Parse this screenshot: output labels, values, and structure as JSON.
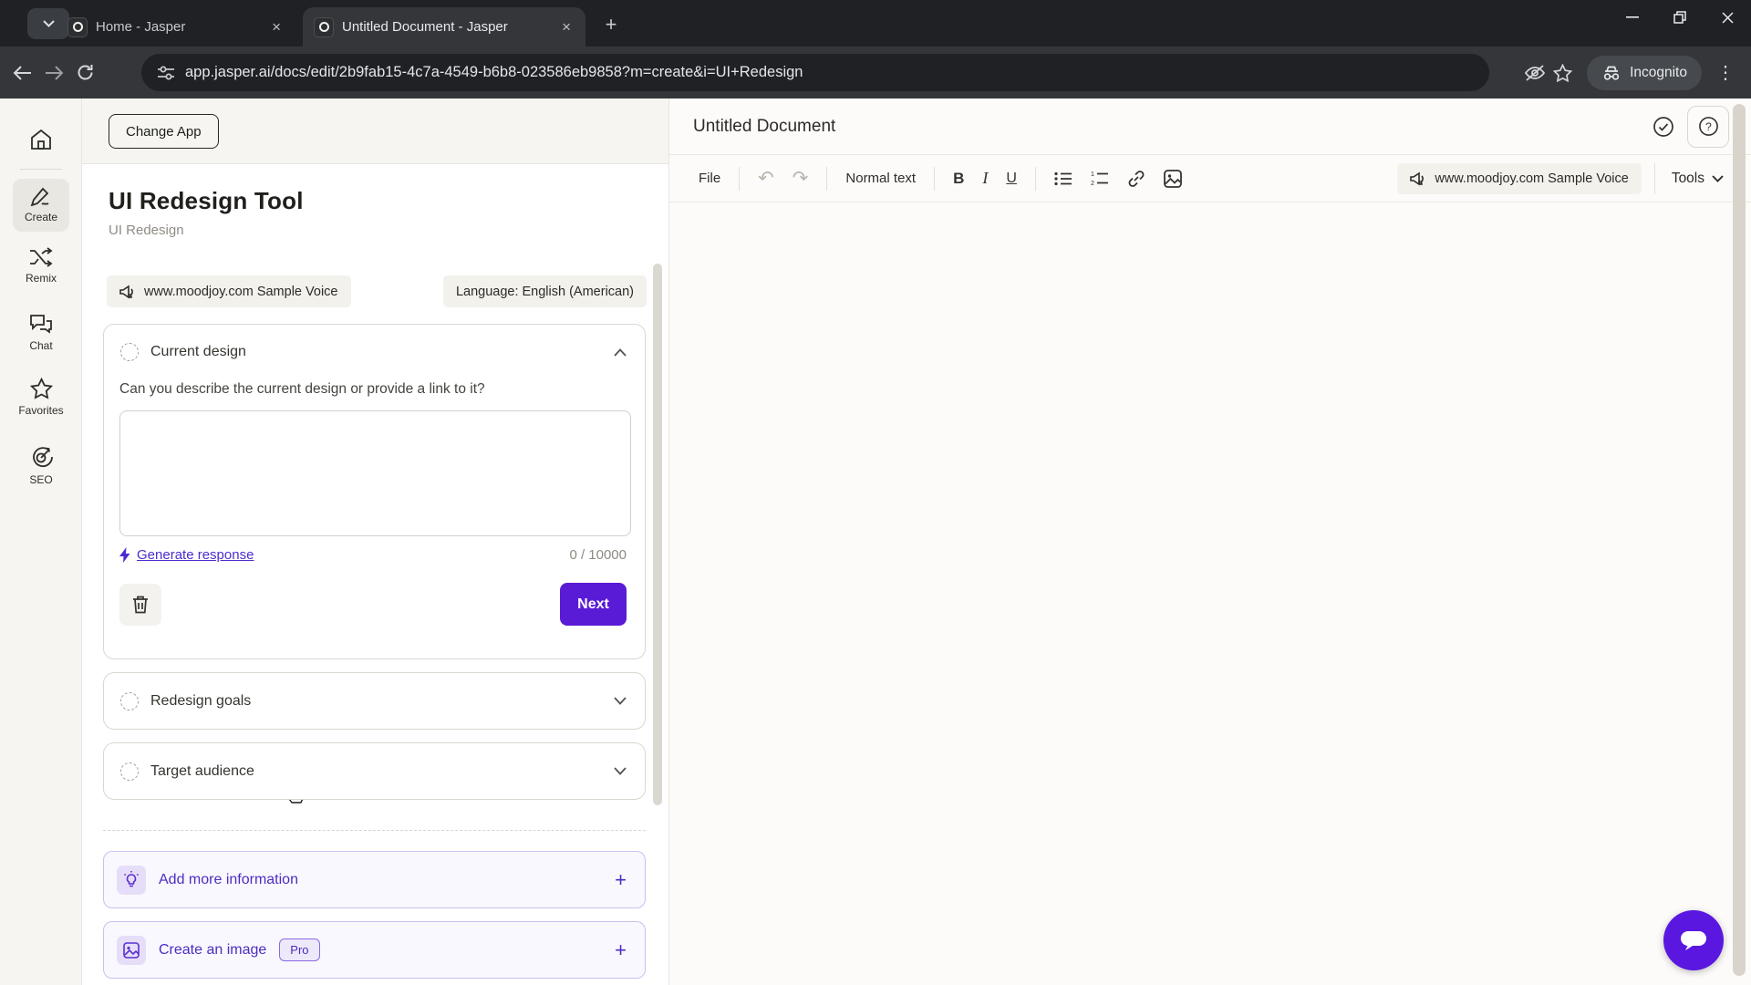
{
  "browser": {
    "tabs": [
      {
        "title": "Home - Jasper"
      },
      {
        "title": "Untitled Document - Jasper"
      }
    ],
    "url": "app.jasper.ai/docs/edit/2b9fab15-4c7a-4549-b6b8-023586eb9858?m=create&i=UI+Redesign",
    "incognito_label": "Incognito"
  },
  "sidebar": {
    "items": [
      {
        "label": "Create"
      },
      {
        "label": "Remix"
      },
      {
        "label": "Chat"
      },
      {
        "label": "Favorites"
      },
      {
        "label": "SEO"
      }
    ]
  },
  "panel": {
    "change_app": "Change App",
    "title": "UI Redesign Tool",
    "subtitle": "UI Redesign",
    "voice_chip": "www.moodjoy.com Sample Voice",
    "language_chip": "Language: English (American)",
    "current_design": {
      "title": "Current design",
      "question": "Can you describe the current design or provide a link to it?",
      "textarea_value": "",
      "generate_label": "Generate response",
      "counter": "0 / 10000",
      "next_label": "Next"
    },
    "accordions": [
      {
        "title": "Redesign goals"
      },
      {
        "title": "Target audience"
      }
    ],
    "extras": [
      {
        "label": "Add more information"
      },
      {
        "label": "Create an image",
        "badge": "Pro"
      }
    ]
  },
  "editor": {
    "doc_title": "Untitled Document",
    "toolbar": {
      "file": "File",
      "style": "Normal text",
      "bold": "B",
      "italic": "I",
      "underline": "U",
      "voice_chip": "www.moodjoy.com Sample Voice",
      "tools": "Tools"
    }
  },
  "colors": {
    "accent": "#5a1bd6",
    "link": "#4e2bd0",
    "chrome_dark": "#202124",
    "chrome_mid": "#35363a",
    "rail_bg": "#f6f5f1"
  }
}
